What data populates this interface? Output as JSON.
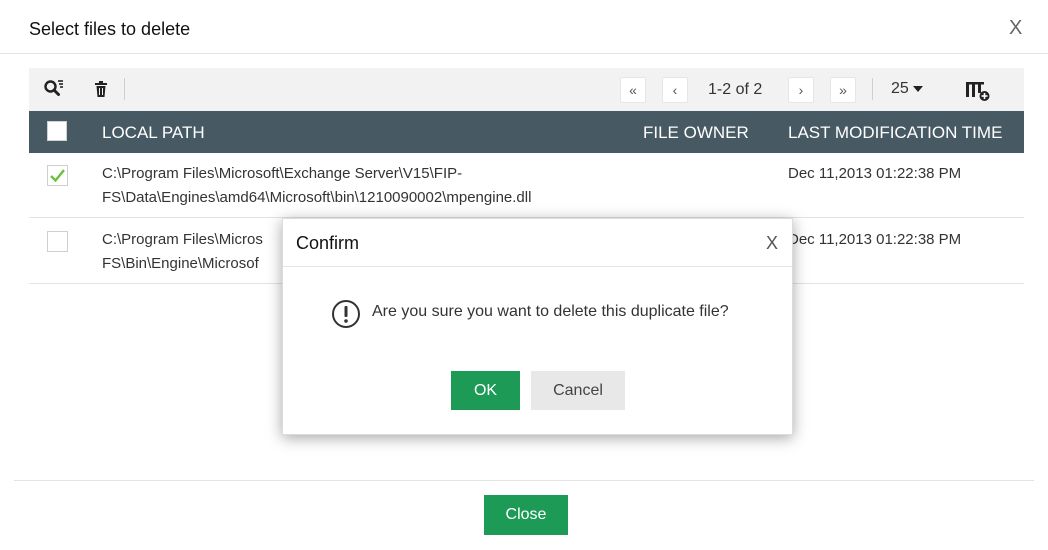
{
  "dialog": {
    "title": "Select files to delete",
    "close_symbol": "X"
  },
  "toolbar": {
    "icons": [
      "search-filter-icon",
      "trash-icon",
      "first-page-icon",
      "prev-page-icon",
      "next-page-icon",
      "last-page-icon",
      "column-settings-icon"
    ],
    "pagination_info": "1-2 of 2",
    "first_symbol": "«",
    "prev_symbol": "‹",
    "next_symbol": "›",
    "last_symbol": "»",
    "per_page": "25"
  },
  "table": {
    "columns": [
      "LOCAL PATH",
      "FILE OWNER",
      "LAST MODIFICATION TIME"
    ],
    "header_bg": "#475963",
    "rows": [
      {
        "checked": true,
        "path_line1": "C:\\Program Files\\Microsoft\\Exchange Server\\V15\\FIP-",
        "path_line2": "FS\\Data\\Engines\\amd64\\Microsoft\\bin\\1210090002\\mpengine.dll",
        "owner": "",
        "modified": "Dec 11,2013 01:22:38 PM"
      },
      {
        "checked": false,
        "path_line1": "C:\\Program Files\\Micros",
        "path_line2": "FS\\Bin\\Engine\\Microsof",
        "owner": "",
        "modified": "Dec 11,2013 01:22:38 PM"
      }
    ]
  },
  "confirm": {
    "title": "Confirm",
    "close_symbol": "X",
    "message": "Are you sure you want to delete this duplicate file?",
    "ok_label": "OK",
    "cancel_label": "Cancel",
    "icon": "exclamation-circle-icon"
  },
  "footer": {
    "close_label": "Close"
  },
  "colors": {
    "primary_green": "#1e9a57",
    "check_green": "#6cbf3a"
  }
}
